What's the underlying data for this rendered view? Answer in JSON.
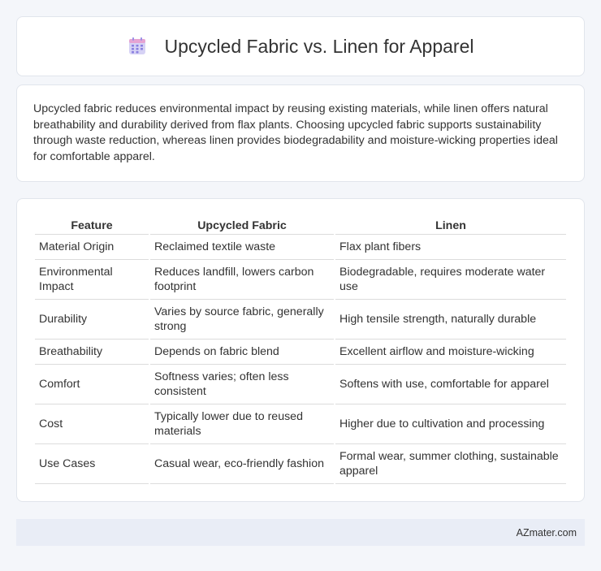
{
  "header": {
    "icon": "calendar-icon",
    "title": "Upcycled Fabric vs. Linen for Apparel"
  },
  "description": "Upcycled fabric reduces environmental impact by reusing existing materials, while linen offers natural breathability and durability derived from flax plants. Choosing upcycled fabric supports sustainability through waste reduction, whereas linen provides biodegradability and moisture-wicking properties ideal for comfortable apparel.",
  "table": {
    "headers": [
      "Feature",
      "Upcycled Fabric",
      "Linen"
    ],
    "rows": [
      [
        "Material Origin",
        "Reclaimed textile waste",
        "Flax plant fibers"
      ],
      [
        "Environmental Impact",
        "Reduces landfill, lowers carbon footprint",
        "Biodegradable, requires moderate water use"
      ],
      [
        "Durability",
        "Varies by source fabric, generally strong",
        "High tensile strength, naturally durable"
      ],
      [
        "Breathability",
        "Depends on fabric blend",
        "Excellent airflow and moisture-wicking"
      ],
      [
        "Comfort",
        "Softness varies; often less consistent",
        "Softens with use, comfortable for apparel"
      ],
      [
        "Cost",
        "Typically lower due to reused materials",
        "Higher due to cultivation and processing"
      ],
      [
        "Use Cases",
        "Casual wear, eco-friendly fashion",
        "Formal wear, summer clothing, sustainable apparel"
      ]
    ]
  },
  "footer": {
    "site": "AZmater.com"
  },
  "colors": {
    "background": "#f4f6fa",
    "card": "#ffffff",
    "footer": "#e9edf6",
    "icon_top": "#e8a6d6",
    "icon_body": "#c9c4f2",
    "icon_grid": "#8a7fe0"
  }
}
